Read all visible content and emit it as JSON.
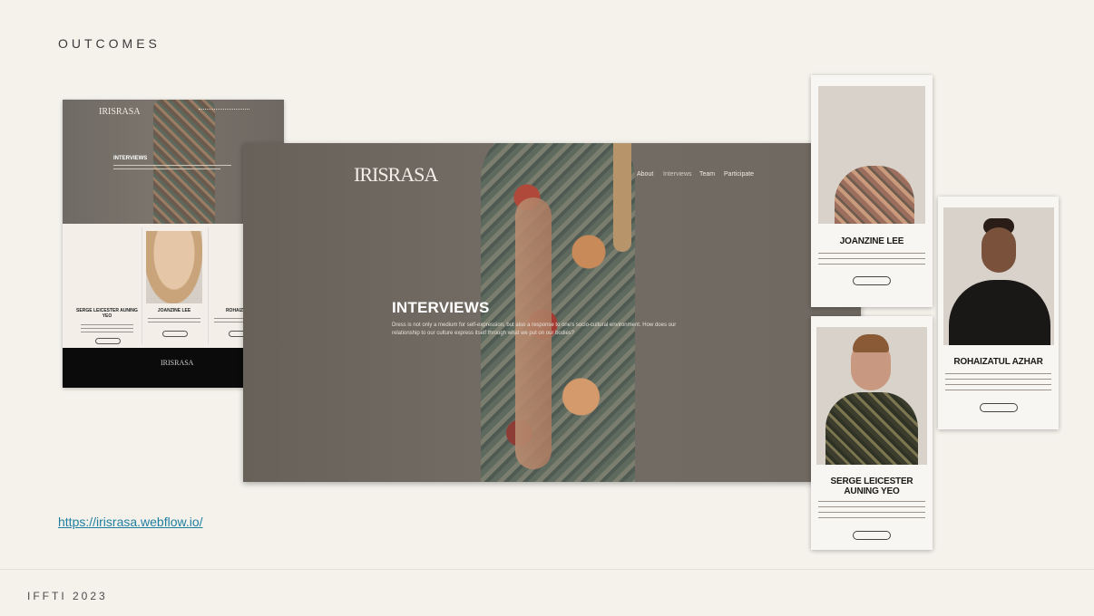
{
  "slide": {
    "title": "OUTCOMES",
    "link": "https://irisrasa.webflow.io/",
    "footer": "IFFTI 2023"
  },
  "site": {
    "logo": "IRISRASA",
    "nav": [
      "About",
      "Interviews",
      "Team",
      "Participate"
    ],
    "hero_title": "INTERVIEWS",
    "hero_desc": "Dress is not only a medium for self-expression, but also a response to one's socio-cultural environment. How does our relationship to our culture express itself through what we put on our bodies?"
  },
  "thumb_people": [
    {
      "name": "SERGE LEICESTER AUNING YEO"
    },
    {
      "name": "JOANZINE LEE"
    },
    {
      "name": "ROHAIZATUL"
    }
  ],
  "people": {
    "joanzine": {
      "name": "JOANZINE LEE"
    },
    "rohaizatul": {
      "name": "ROHAIZATUL AZHAR"
    },
    "serge": {
      "name": "SERGE LEICESTER AUNING YEO"
    }
  }
}
